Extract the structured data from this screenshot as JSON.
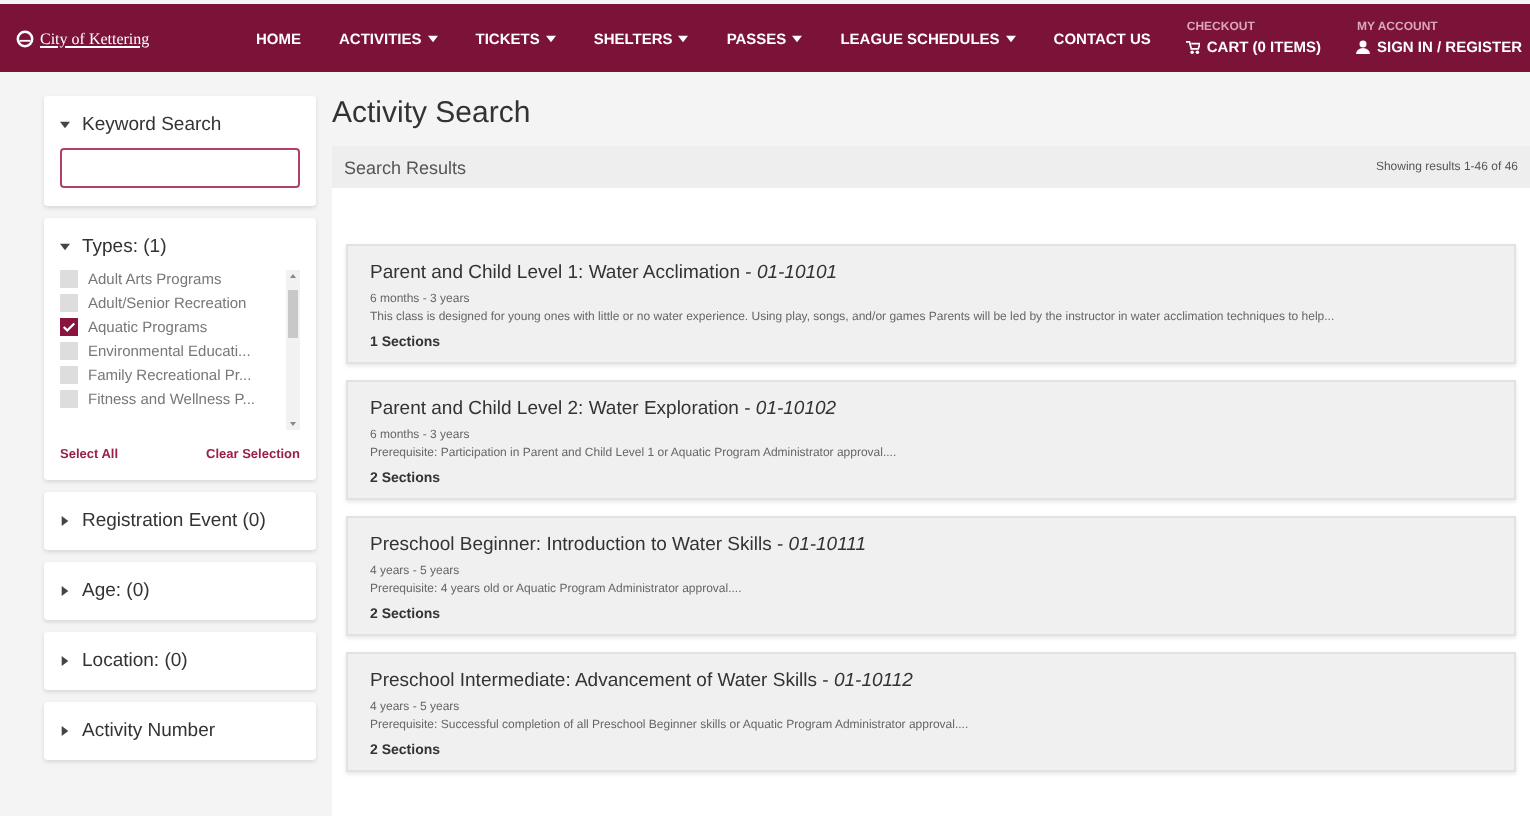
{
  "nav": {
    "logo": "City of Kettering",
    "items": [
      {
        "label": "HOME",
        "dropdown": false
      },
      {
        "label": "ACTIVITIES",
        "dropdown": true
      },
      {
        "label": "TICKETS",
        "dropdown": true
      },
      {
        "label": "SHELTERS",
        "dropdown": true
      },
      {
        "label": "PASSES",
        "dropdown": true
      },
      {
        "label": "LEAGUE SCHEDULES",
        "dropdown": true
      },
      {
        "label": "CONTACT US",
        "dropdown": false
      }
    ],
    "cart": {
      "caption": "CHECKOUT",
      "label": "CART (0 ITEMS)"
    },
    "account": {
      "caption": "MY ACCOUNT",
      "label": "SIGN IN / REGISTER"
    }
  },
  "filters": [
    {
      "kind": "search",
      "title": "Keyword Search",
      "expanded": true
    },
    {
      "kind": "checklist",
      "title": "Types:  (1)",
      "expanded": true,
      "options": [
        {
          "label": "Adult Arts Programs",
          "checked": false
        },
        {
          "label": "Adult/Senior Recreation",
          "checked": false
        },
        {
          "label": "Aquatic Programs",
          "checked": true
        },
        {
          "label": "Environmental Educati...",
          "checked": false
        },
        {
          "label": "Family Recreational Pr...",
          "checked": false
        },
        {
          "label": "Fitness and Wellness P...",
          "checked": false
        }
      ],
      "select_all": "Select All",
      "clear": "Clear Selection"
    },
    {
      "kind": "plain",
      "title": "Registration Event  (0)",
      "expanded": false
    },
    {
      "kind": "plain",
      "title": "Age:  (0)",
      "expanded": false
    },
    {
      "kind": "plain",
      "title": "Location:  (0)",
      "expanded": false
    },
    {
      "kind": "plain",
      "title": "Activity Number",
      "expanded": false
    }
  ],
  "page_title": "Activity Search",
  "results_header": {
    "title": "Search Results",
    "count": "Showing results 1-46 of 46"
  },
  "results": [
    {
      "title": "Parent and Child Level 1: Water Acclimation - *01-10101*",
      "age": "6 months - 3 years",
      "description": "This class is designed for young ones with little or no water experience. Using play, songs, and/or games Parents will be led by the instructor in water acclimation techniques to help...",
      "sections": "1 Sections"
    },
    {
      "title": "Parent and Child Level 2: Water Exploration - *01-10102*",
      "age": "6 months - 3 years",
      "description": "Prerequisite: Participation in Parent and Child Level 1 or Aquatic Program Administrator approval....",
      "sections": "2 Sections"
    },
    {
      "title": "Preschool Beginner: Introduction to Water Skills - *01-10111*",
      "age": "4 years - 5 years",
      "description": "Prerequisite: 4 years old or Aquatic Program Administrator approval....",
      "sections": "2 Sections"
    },
    {
      "title": "Preschool Intermediate: Advancement of Water Skills - *01-10112*",
      "age": "4 years - 5 years",
      "description": "Prerequisite: Successful completion of all Preschool Beginner skills or Aquatic Program Administrator approval....",
      "sections": "2 Sections"
    }
  ]
}
